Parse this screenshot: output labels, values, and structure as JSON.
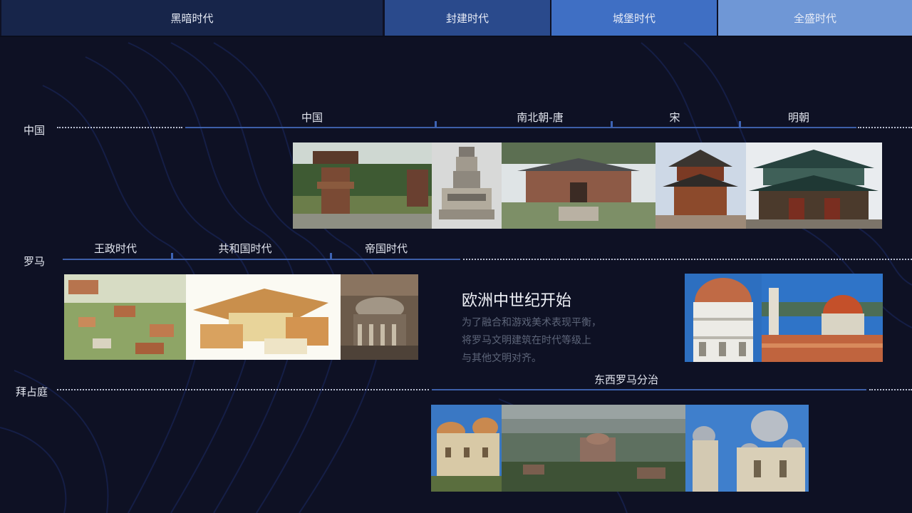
{
  "era_tabs": [
    {
      "label": "黑暗时代"
    },
    {
      "label": "封建时代"
    },
    {
      "label": "城堡时代"
    },
    {
      "label": "全盛时代"
    }
  ],
  "rows": {
    "china": {
      "label": "中国",
      "periods": [
        "中国",
        "南北朝-唐",
        "宋",
        "明朝"
      ]
    },
    "rome": {
      "label": "罗马",
      "periods": [
        "王政时代",
        "共和国时代",
        "帝国时代"
      ]
    },
    "byzantium": {
      "label": "拜占庭",
      "periods": [
        "东西罗马分治"
      ]
    }
  },
  "note": {
    "title": "欧洲中世纪开始",
    "lines": [
      "为了融合和游戏美术表现平衡，",
      "将罗马文明建筑在时代等级上",
      "与其他文明对齐。"
    ]
  },
  "colors": {
    "background": "#0e1124",
    "tab_dark": "#17254a",
    "tab_feudal": "#2a4a8c",
    "tab_castle": "#3f6fc4",
    "tab_imperial": "#6f97d6",
    "timeline": "#3d5fa8"
  }
}
